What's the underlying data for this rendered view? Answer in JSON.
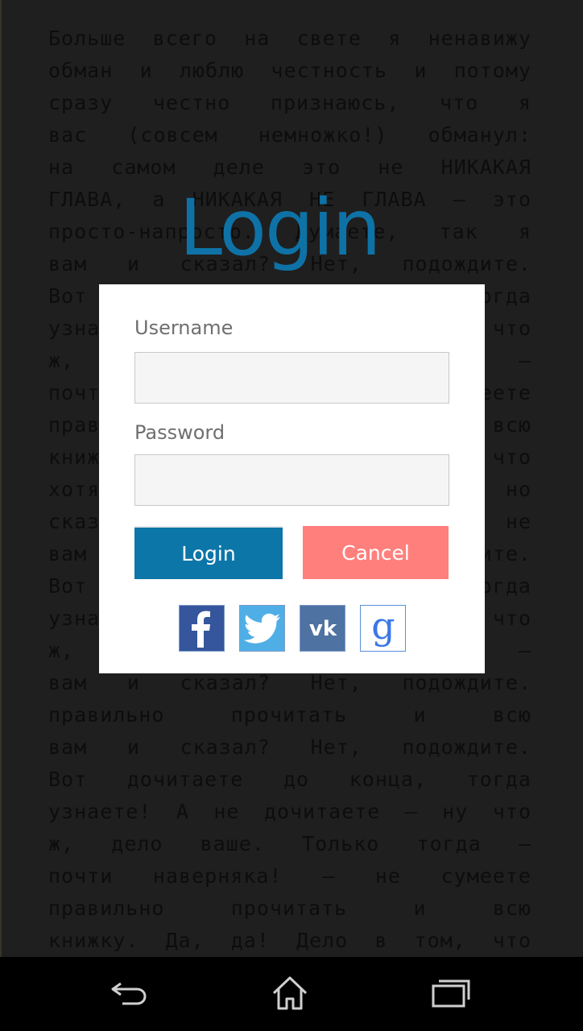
{
  "book": {
    "lines": [
      "Больше всего на свете я ненавижу",
      "обман и люблю честность и потому",
      "сразу честно признаюсь, что я",
      "вас (совсем немножко!) обманул:",
      "на самом деле это не НИКАКАЯ",
      "ГЛАВА, а НИКАКАЯ НЕ ГЛАВА – это",
      "просто-напросто. Думаете, так я",
      "вам и сказал? Нет, подождите.",
      "Вот дочитаете до конца, тогда",
      "узнаете! А не дочитаете – ну что",
      "ж, дело ваше. Только тогда –",
      "почти наверняка! – не сумеете",
      "правильно прочитать и всю",
      "книжку. Да, да! Дело в том, что",
      "хотя это и НИКАКАЯ НЕ ГЛАВА, но",
      "сказать я вам хотел бы не",
      "вам и сказал? Нет, подождите.",
      "Вот дочитаете до конца, тогда",
      "узнаете! А не дочитаете – ну что",
      "ж, дело ваше. Только тогда –",
      "вам и сказал? Нет, подождите.",
      "правильно прочитать и всю",
      "вам и сказал? Нет, подождите.",
      "Вот дочитаете до конца, тогда",
      "узнаете! А не дочитаете – ну что",
      "ж, дело ваше. Только тогда –",
      "почти наверняка! – не сумеете",
      "правильно прочитать и всю",
      "книжку. Да, да! Дело в том, что"
    ]
  },
  "title": "Login",
  "form": {
    "username_label": "Username",
    "username_value": "",
    "password_label": "Password",
    "password_value": "",
    "login_button": "Login",
    "cancel_button": "Cancel"
  },
  "social": [
    "facebook-icon",
    "twitter-icon",
    "vk-icon",
    "google-icon"
  ],
  "colors": {
    "title": "#0e72a6",
    "login_button": "#0d76a8",
    "cancel_button": "#ff7f7c"
  },
  "navbar": [
    "back-icon",
    "home-icon",
    "recent-apps-icon"
  ]
}
